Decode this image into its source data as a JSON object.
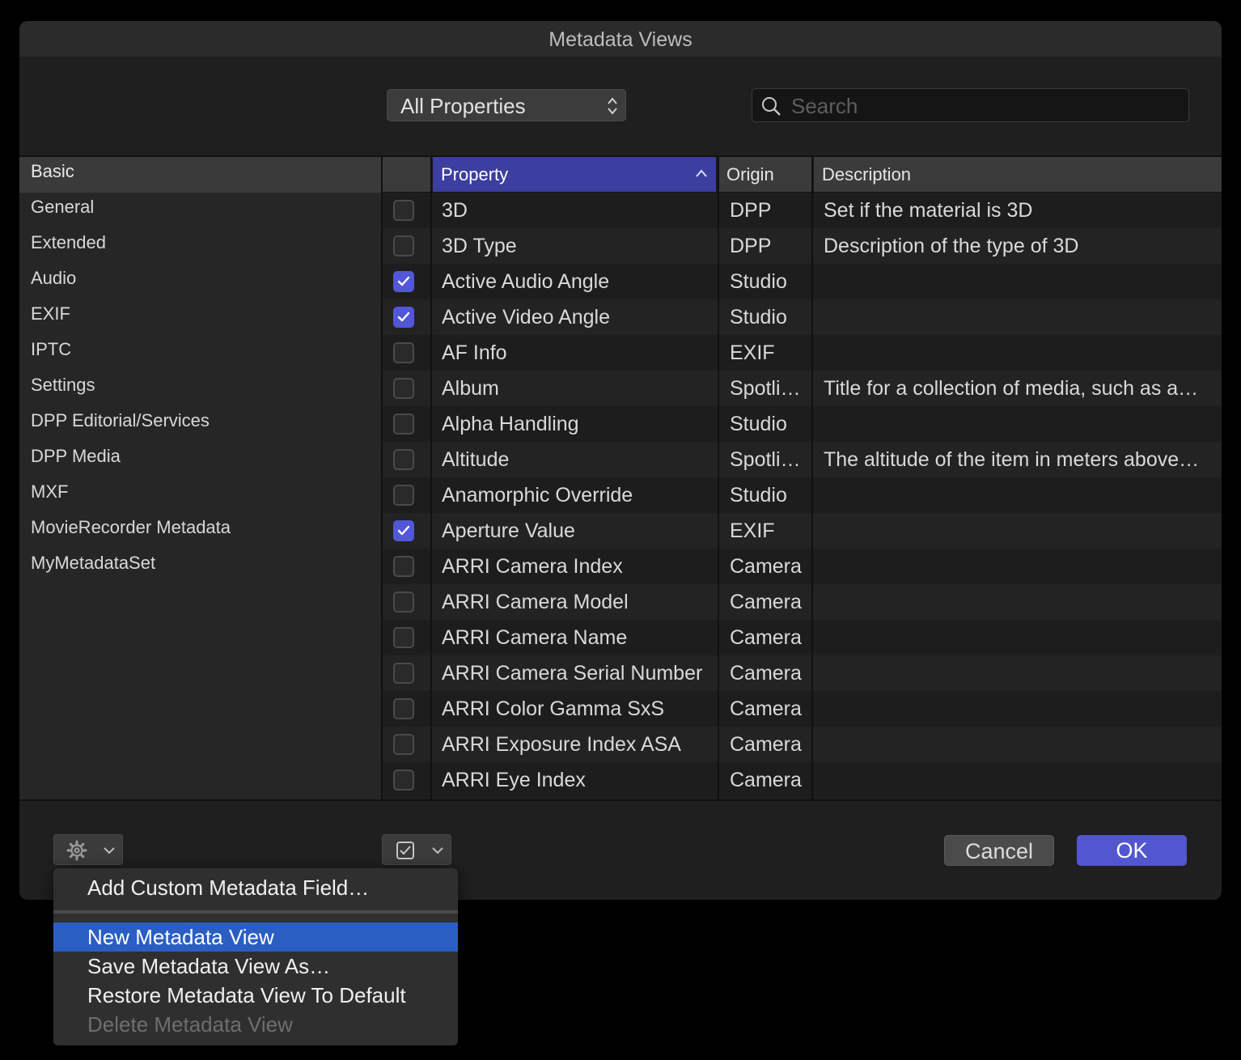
{
  "window": {
    "title": "Metadata Views"
  },
  "toolbar": {
    "view_select": "All Properties",
    "search_placeholder": "Search"
  },
  "sidebar": {
    "items": [
      {
        "label": "Basic",
        "selected": true
      },
      {
        "label": "General"
      },
      {
        "label": "Extended"
      },
      {
        "label": "Audio"
      },
      {
        "label": "EXIF"
      },
      {
        "label": "IPTC"
      },
      {
        "label": "Settings"
      },
      {
        "label": "DPP Editorial/Services"
      },
      {
        "label": "DPP Media"
      },
      {
        "label": "MXF"
      },
      {
        "label": "MovieRecorder Metadata"
      },
      {
        "label": "MyMetadataSet"
      }
    ]
  },
  "table": {
    "columns": {
      "property": "Property",
      "origin": "Origin",
      "description": "Description"
    },
    "rows": [
      {
        "checked": false,
        "property": "3D",
        "origin": "DPP",
        "description": "Set if the material is 3D"
      },
      {
        "checked": false,
        "property": "3D Type",
        "origin": "DPP",
        "description": "Description of the type of 3D"
      },
      {
        "checked": true,
        "property": "Active Audio Angle",
        "origin": "Studio",
        "description": ""
      },
      {
        "checked": true,
        "property": "Active Video Angle",
        "origin": "Studio",
        "description": ""
      },
      {
        "checked": false,
        "property": "AF Info",
        "origin": "EXIF",
        "description": ""
      },
      {
        "checked": false,
        "property": "Album",
        "origin": "Spotli…",
        "description": "Title for a collection of media, such as a…"
      },
      {
        "checked": false,
        "property": "Alpha Handling",
        "origin": "Studio",
        "description": ""
      },
      {
        "checked": false,
        "property": "Altitude",
        "origin": "Spotli…",
        "description": "The altitude of the item in meters above…"
      },
      {
        "checked": false,
        "property": "Anamorphic Override",
        "origin": "Studio",
        "description": ""
      },
      {
        "checked": true,
        "property": "Aperture Value",
        "origin": "EXIF",
        "description": ""
      },
      {
        "checked": false,
        "property": "ARRI Camera Index",
        "origin": "Camera",
        "description": ""
      },
      {
        "checked": false,
        "property": "ARRI Camera Model",
        "origin": "Camera",
        "description": ""
      },
      {
        "checked": false,
        "property": "ARRI Camera Name",
        "origin": "Camera",
        "description": ""
      },
      {
        "checked": false,
        "property": "ARRI Camera Serial Number",
        "origin": "Camera",
        "description": ""
      },
      {
        "checked": false,
        "property": "ARRI Color Gamma SxS",
        "origin": "Camera",
        "description": ""
      },
      {
        "checked": false,
        "property": "ARRI Exposure Index ASA",
        "origin": "Camera",
        "description": ""
      },
      {
        "checked": false,
        "property": "ARRI Eye Index",
        "origin": "Camera",
        "description": ""
      }
    ]
  },
  "buttons": {
    "cancel": "Cancel",
    "ok": "OK"
  },
  "action_menu": {
    "items": [
      {
        "label": "Add Custom Metadata Field…",
        "enabled": true
      },
      {
        "label": "New Metadata View",
        "enabled": true,
        "highlighted": true
      },
      {
        "label": "Save Metadata View As…",
        "enabled": true
      },
      {
        "label": "Restore Metadata View To Default",
        "enabled": true
      },
      {
        "label": "Delete Metadata View",
        "enabled": false
      }
    ]
  },
  "colors": {
    "accent": "#5257d8",
    "menu_highlight": "#2a5ec2",
    "header_selected": "#3c3ea0"
  },
  "icons": {
    "gear": "gear-icon",
    "checkbox_menu": "checkbox-icon",
    "search": "search-icon"
  }
}
